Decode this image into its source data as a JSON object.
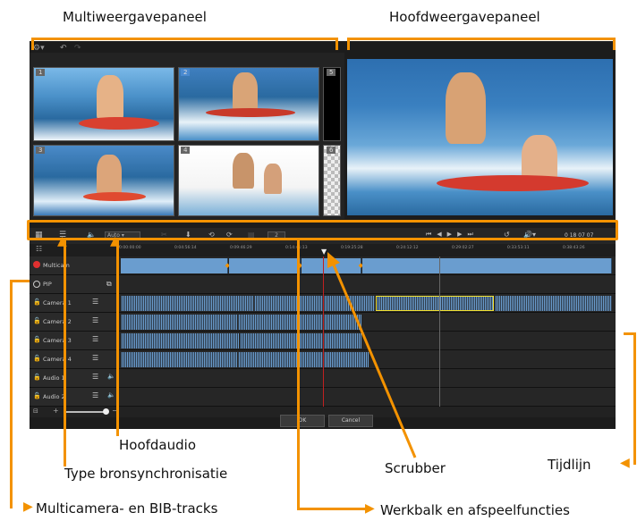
{
  "annotations": {
    "multiview": "Multiweergavepaneel",
    "main_view": "Hoofdweergavepaneel",
    "main_audio": "Hoofdaudio",
    "source_sync": "Type bronsynchronisatie",
    "scrubber": "Scrubber",
    "timeline": "Tijdlijn",
    "tracks": "Multicamera- en BIB-tracks",
    "toolbar": "Werkbalk en afspeelfuncties"
  },
  "multiview": {
    "tiles": [
      "1",
      "2",
      "3",
      "4"
    ],
    "side": [
      "5",
      "6"
    ]
  },
  "toolbar": {
    "auto_label": "Auto",
    "timecode": "0 18 07 07",
    "speed": "2"
  },
  "ruler": [
    "0:00:00:00",
    "0:04:56:14",
    "0:09:46:29",
    "0:14:41:13",
    "0:19:25:28",
    "0:24:12:12",
    "0:29:02:27",
    "0:33:53:11",
    "0:38:43:26"
  ],
  "tracks": [
    "Multicam",
    "PIP",
    "Camera 1",
    "Camera 2",
    "Camera 3",
    "Camera 4",
    "Audio 1",
    "Audio 2"
  ],
  "buttons": {
    "ok": "OK",
    "cancel": "Cancel"
  },
  "colors": {
    "annotation": "#f39200",
    "clip": "#6a9dcf",
    "app_bg": "#1c1c1c"
  }
}
